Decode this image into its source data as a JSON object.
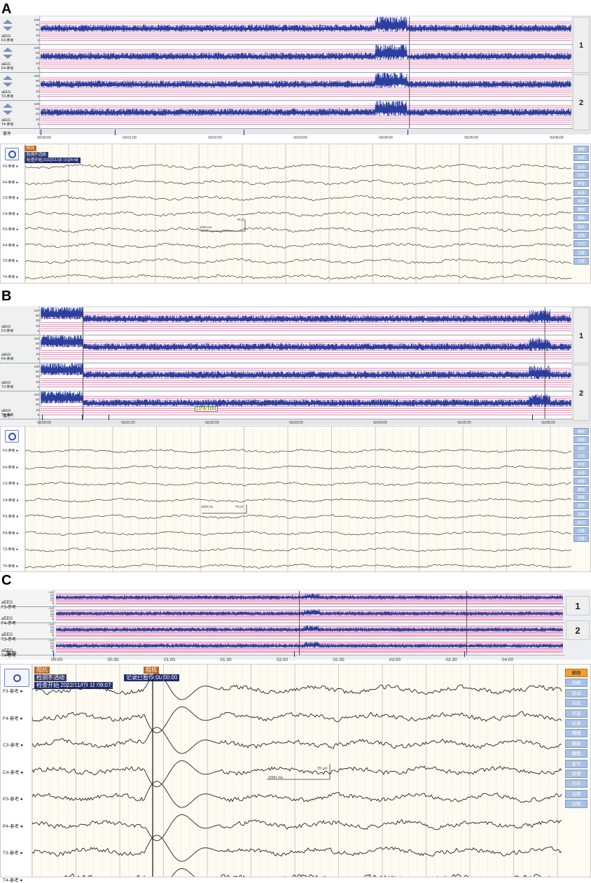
{
  "panels": [
    {
      "label": "A",
      "aeeg_rows": [
        {
          "name": "aEEG",
          "channel": "F3-参考"
        },
        {
          "name": "aEEG",
          "channel": "F4-参考"
        },
        {
          "name": "aEEG",
          "channel": "T3-参考"
        },
        {
          "name": "aEEG",
          "channel": "T4-参考"
        }
      ],
      "yticks": [
        "100",
        "50",
        "25",
        "10",
        "5"
      ],
      "group_buttons": [
        "1",
        "2"
      ],
      "events_label": "事件",
      "time_ticks": [
        "0d:00:00",
        "0d:01:00",
        "0d:02:00",
        "0d:03:00",
        "0d:04:00",
        "0d:05:00",
        "0d:06:00"
      ],
      "badges": [
        "阻抗",
        "检测不活动",
        "检查开始 2022/11/16 15:24:48"
      ],
      "channels": [
        "F3-参考 ●",
        "F4-参考 ●",
        "C3-参考 ●",
        "C4-参考 ●",
        "P3-参考 ●",
        "P4-参考 ●",
        "T3-参考 ●",
        "T4-参考 ●"
      ],
      "scale_time": "1000 ms",
      "scale_amp": "70 µV",
      "right_buttons": [
        "静眼",
        "闭眼",
        "运动",
        "闪光",
        "声音",
        "话语",
        "嗜睡",
        "癫痫",
        "睡眠",
        "发作",
        "剪辑",
        "打印",
        "注释",
        "注释"
      ],
      "active_button": -1
    },
    {
      "label": "B",
      "aeeg_rows": [
        {
          "name": "aEEG",
          "channel": "F3-参考"
        },
        {
          "name": "aEEG",
          "channel": "F4-参考"
        },
        {
          "name": "aEEG",
          "channel": "T3-参考"
        },
        {
          "name": "aEEG",
          "channel": "T4-参考"
        }
      ],
      "yticks": [
        "100",
        "50",
        "25",
        "10",
        "5"
      ],
      "group_buttons": [
        "1",
        "2"
      ],
      "events_label": "事件",
      "time_ticks": [
        "0d:00:00",
        "0d:01:00",
        "0d:02:00",
        "0d:03:00",
        "0d:04:00",
        "0d:05:00",
        "0d:06:00"
      ],
      "tooltip": "[ 17.6; 11.6 ]",
      "badges": [],
      "channels": [
        "F3-参考 ●",
        "F4-参考 ●",
        "C3-参考 ●",
        "C4-参考 ●",
        "P3-参考 ●",
        "P4-参考 ●",
        "T3-参考 ●",
        "T4-参考 ●"
      ],
      "scale_time": "1000 ms",
      "scale_amp": "70 µV",
      "right_buttons": [
        "静眼",
        "闭眼",
        "运动",
        "闪光",
        "声音",
        "话语",
        "嗜睡",
        "癫痫",
        "睡眠",
        "发作",
        "剪辑",
        "EEG",
        "注释",
        "注释"
      ],
      "active_button": -1
    },
    {
      "label": "C",
      "aeeg_rows": [
        {
          "name": "aEEG",
          "channel": "F3-参考"
        },
        {
          "name": "aEEG",
          "channel": "F4-参考"
        },
        {
          "name": "aEEG",
          "channel": "T3-参考"
        },
        {
          "name": "aEEG",
          "channel": "T4-参考"
        }
      ],
      "yticks": [
        "100",
        "50",
        "25",
        "10",
        "5"
      ],
      "group_buttons": [
        "1",
        "2"
      ],
      "events_label": "事件",
      "time_ticks": [
        "00:00",
        "00:30",
        "01:00",
        "01:30",
        "02:00",
        "02:30",
        "03:00",
        "03:30",
        "04:00"
      ],
      "badges": [
        "阻抗",
        "检测不活动",
        "检查开始 2022/11/09 11:09:07",
        "阻抗",
        "记录已暂停 00:00:00"
      ],
      "channels": [
        "F3-参考 ●",
        "F4-参考 ●",
        "C3-参考 ●",
        "C4-参考 ●",
        "P3-参考 ●",
        "P4-参考 ●",
        "T3-参考 ●",
        "T4-参考 ●"
      ],
      "scale_time": "1000 ms",
      "scale_amp": "70 µV",
      "right_buttons": [
        "静眼",
        "闭眼",
        "运动",
        "闪光",
        "声音",
        "话语",
        "嗜睡",
        "癫痫",
        "睡眠",
        "发作",
        "剪辑",
        "打印",
        "注释",
        "注释"
      ],
      "active_button": 0
    }
  ],
  "colors": {
    "trace_blue": "#2a3f9e",
    "band_pink": "#e0468a",
    "eeg_line": "#222222",
    "button_blue": "#a9c1e2",
    "active_orange": "#f0a030"
  }
}
